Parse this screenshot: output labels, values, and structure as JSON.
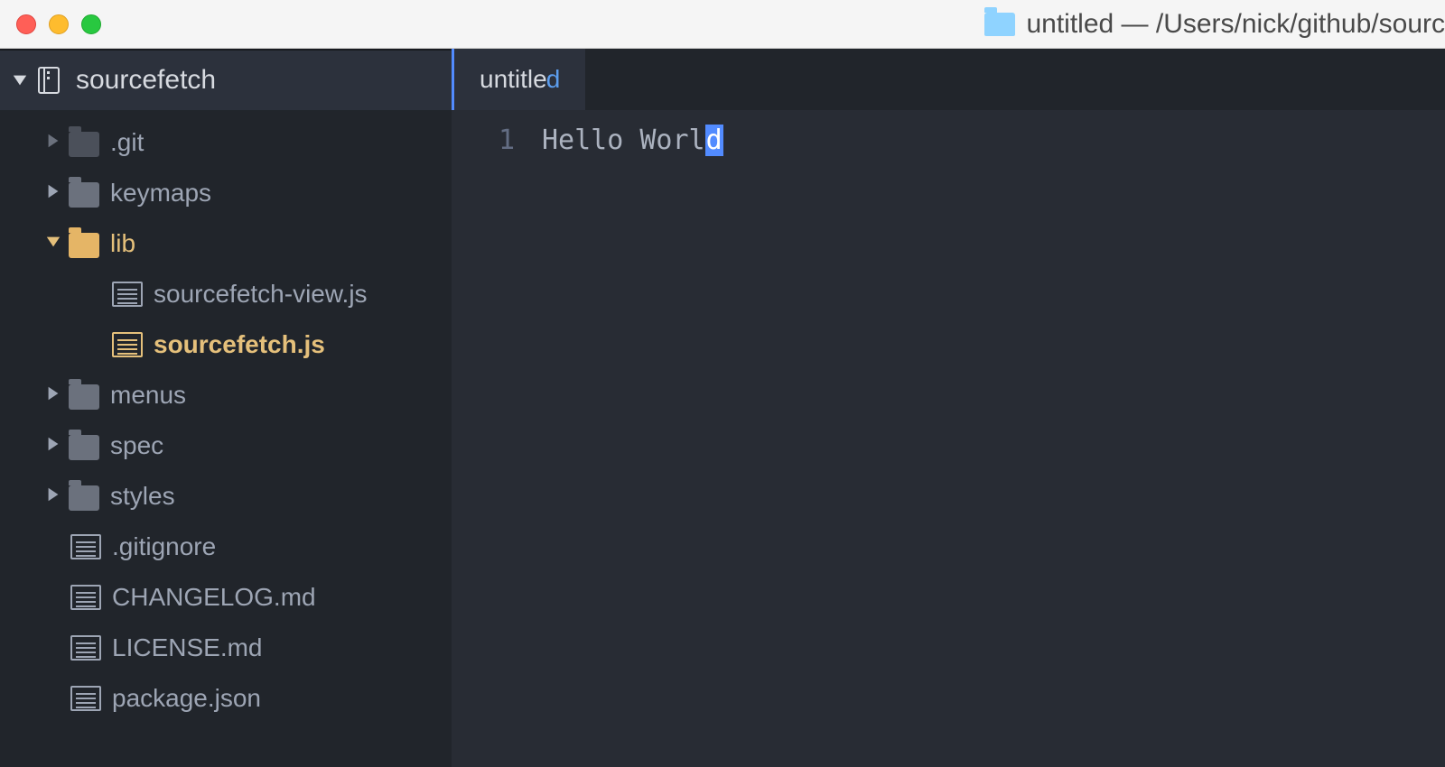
{
  "window": {
    "title": "untitled — /Users/nick/github/sourc"
  },
  "sidebar": {
    "project": "sourcefetch",
    "items": [
      {
        "kind": "folder",
        "label": ".git",
        "expanded": false,
        "tone": "dim"
      },
      {
        "kind": "folder",
        "label": "keymaps",
        "expanded": false,
        "tone": "grey"
      },
      {
        "kind": "folder",
        "label": "lib",
        "expanded": true,
        "tone": "gold",
        "children": [
          {
            "kind": "file",
            "label": "sourcefetch-view.js",
            "highlight": false
          },
          {
            "kind": "file",
            "label": "sourcefetch.js",
            "highlight": true
          }
        ]
      },
      {
        "kind": "folder",
        "label": "menus",
        "expanded": false,
        "tone": "grey"
      },
      {
        "kind": "folder",
        "label": "spec",
        "expanded": false,
        "tone": "grey"
      },
      {
        "kind": "folder",
        "label": "styles",
        "expanded": false,
        "tone": "grey"
      },
      {
        "kind": "file",
        "label": ".gitignore"
      },
      {
        "kind": "file",
        "label": "CHANGELOG.md"
      },
      {
        "kind": "file",
        "label": "LICENSE.md"
      },
      {
        "kind": "file",
        "label": "package.json"
      }
    ]
  },
  "editor": {
    "tab_label": "untitle",
    "tab_modified_glyph": "d",
    "gutter": {
      "line1": "1"
    },
    "line1_pre": "Hello Worl",
    "line1_sel": "d"
  }
}
